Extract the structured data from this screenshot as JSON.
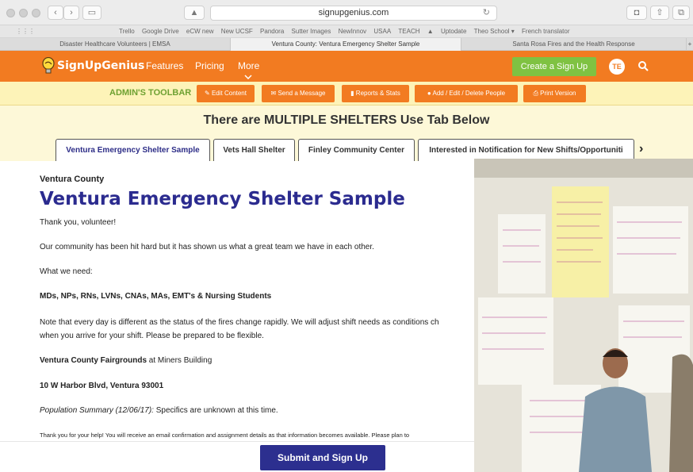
{
  "browser": {
    "url": "signupgenius.com",
    "bookmarks": [
      "Trello",
      "Google Drive",
      "eCW new",
      "New UCSF",
      "Pandora",
      "Sutter Images",
      "NewInnov",
      "USAA",
      "TEACH",
      "▲",
      "Uptodate",
      "Theo School ▾",
      "French translator"
    ],
    "tabs": [
      {
        "label": "Disaster Healthcare Volunteers | EMSA",
        "active": false
      },
      {
        "label": "Ventura County: Ventura Emergency Shelter Sample",
        "active": true
      },
      {
        "label": "Santa Rosa Fires and the Health Response",
        "active": false
      }
    ]
  },
  "site": {
    "logo": "SignUpGenius",
    "nav": [
      "Features",
      "Pricing",
      "More"
    ],
    "create_label": "Create a Sign Up",
    "avatar_initials": "TE"
  },
  "admin": {
    "label": "ADMIN'S TOOLBAR",
    "buttons": [
      "Edit Content",
      "Send a Message",
      "Reports & Stats",
      "Add / Edit / Delete People",
      "Print Version"
    ]
  },
  "shelters": {
    "headline": "There are MULTIPLE SHELTERS Use Tab Below",
    "tabs": [
      "Ventura Emergency Shelter Sample",
      "Vets Hall Shelter",
      "Finley Community Center",
      "Interested in Notification for New Shifts/Opportuniti"
    ]
  },
  "content": {
    "eyebrow": "Ventura County",
    "title": "Ventura Emergency Shelter Sample",
    "p1": "Thank you, volunteer!",
    "p2": "Our community has been hit hard but it has shown us what a great team we have in each other.",
    "p3": "What we need:",
    "p4": "MDs, NPs, RNs, LVNs, CNAs, MAs, EMT's & Nursing Students",
    "p5a": "Note that every day is different as the status of the fires change rapidly. We will adjust shift needs as conditions ch",
    "p5b": "when you arrive for your shift. Please be prepared to be flexible.",
    "p6_bold": "Ventura County Fairgrounds",
    "p6_rest": " at Miners Building",
    "p7": "10 W Harbor Blvd, Ventura 93001",
    "p8_em": "Population Summary (12/06/17):",
    "p8_rest": " Specifics are unknown at this time.",
    "p9": "Thank you for your help! You will receive an email confirmation and assignment details as that information becomes available. Please plan to"
  },
  "submit_label": "Submit and Sign Up",
  "colors": {
    "orange": "#f27b21",
    "green": "#7fc242",
    "navy": "#2c2f8f",
    "admin_bg": "#fdf3b8"
  }
}
